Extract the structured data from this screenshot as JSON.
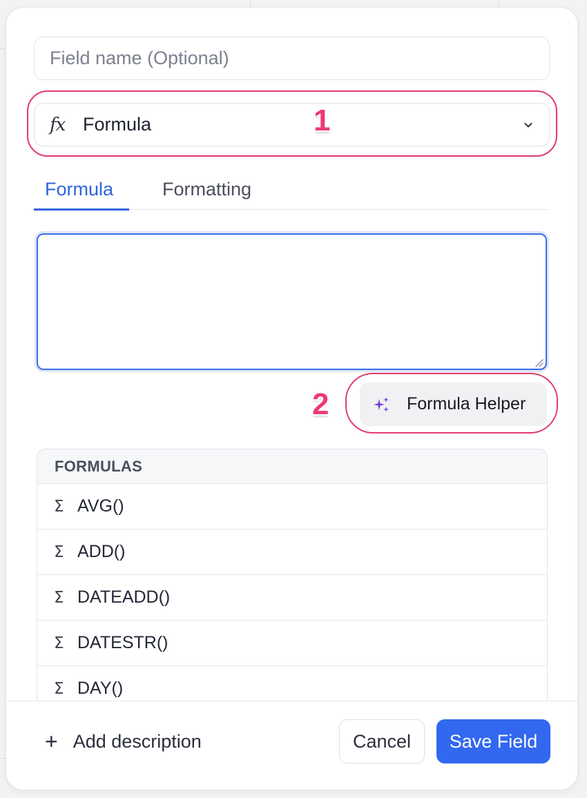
{
  "field_name": {
    "placeholder": "Field name (Optional)",
    "value": ""
  },
  "field_type": {
    "icon": "fx-icon",
    "label": "Formula"
  },
  "tabs": [
    {
      "label": "Formula",
      "active": true
    },
    {
      "label": "Formatting",
      "active": false
    }
  ],
  "formula_editor": {
    "value": ""
  },
  "formula_helper": {
    "label": "Formula Helper",
    "icon": "sparkle-icon"
  },
  "formulas": {
    "header": "FORMULAS",
    "items": [
      {
        "icon": "Σ",
        "label": "AVG()"
      },
      {
        "icon": "Σ",
        "label": "ADD()"
      },
      {
        "icon": "Σ",
        "label": "DATEADD()"
      },
      {
        "icon": "Σ",
        "label": "DATESTR()"
      },
      {
        "icon": "Σ",
        "label": "DAY()"
      }
    ]
  },
  "footer": {
    "add_description_icon": "+",
    "add_description": "Add description",
    "cancel": "Cancel",
    "save": "Save Field"
  },
  "annotations": [
    "1",
    "2"
  ],
  "colors": {
    "accent": "#3268f0",
    "tab_active": "#2f63dd",
    "annotation": "#e2386e",
    "sparkle": "#7b3fd8"
  },
  "fx_glyph": "fx"
}
